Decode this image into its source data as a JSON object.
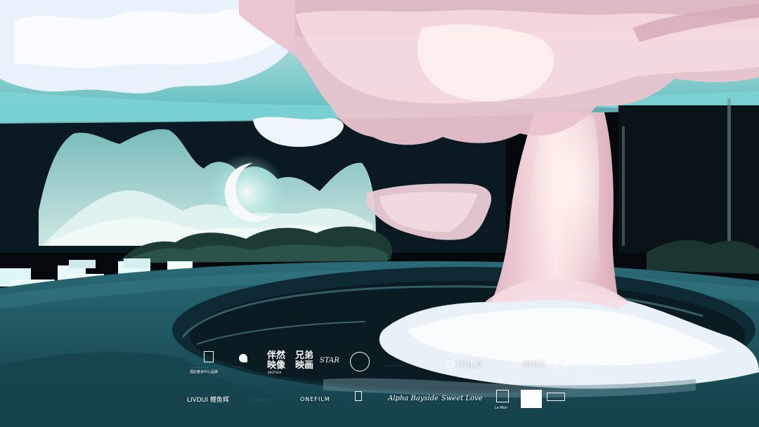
{
  "scene": {
    "colors": {
      "sky": "#05080c",
      "canopy": "#9fe3e6",
      "cloud": "#e7f1fb",
      "mountain": "#bfe6e4",
      "moon": "#f3f6f8",
      "tree": "#f1cdd4",
      "floor": "#1c5560",
      "pool": "#0b1c24"
    }
  },
  "logos": {
    "row1": {
      "hotel": "酒店宴会中心品牌",
      "brand2": "伴然映像",
      "brand2_sub": "BROTHER",
      "brand3": "兄弟映画",
      "star": "STAR",
      "halo": "HALO",
      "bride": "BRIDE"
    },
    "row2": {
      "livdui": "LIVDUI 鲤鱼辉",
      "onefilm": "ONEFILM",
      "alpha": "Alpha Bayside",
      "script2": "Sweet Love",
      "lemon": "Le Mon"
    }
  }
}
